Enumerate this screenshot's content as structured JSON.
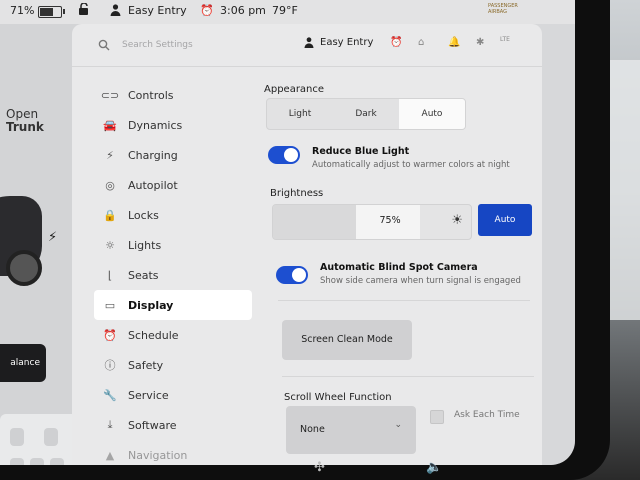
{
  "status_bar": {
    "battery_percent": "71%",
    "battery_level": 0.71,
    "profile_name": "Easy Entry",
    "time": "3:06 pm",
    "temperature": "79°F",
    "airbag_line1": "PASSENGER",
    "airbag_line2": "AIRBAG"
  },
  "car_panel": {
    "trunk_line1": "Open",
    "trunk_line2": "Trunk",
    "balance_label": "alance"
  },
  "settings_header": {
    "search_placeholder": "Search Settings",
    "profile_name": "Easy Entry",
    "lte_label": "LTE"
  },
  "sidebar": {
    "items": [
      {
        "label": "Controls",
        "icon": "toggle-icon"
      },
      {
        "label": "Dynamics",
        "icon": "car-icon"
      },
      {
        "label": "Charging",
        "icon": "bolt-icon"
      },
      {
        "label": "Autopilot",
        "icon": "steering-wheel-icon"
      },
      {
        "label": "Locks",
        "icon": "lock-icon"
      },
      {
        "label": "Lights",
        "icon": "light-icon"
      },
      {
        "label": "Seats",
        "icon": "seat-icon"
      },
      {
        "label": "Display",
        "icon": "display-icon",
        "active": true
      },
      {
        "label": "Schedule",
        "icon": "clock-icon"
      },
      {
        "label": "Safety",
        "icon": "info-icon"
      },
      {
        "label": "Service",
        "icon": "wrench-icon"
      },
      {
        "label": "Software",
        "icon": "download-icon"
      },
      {
        "label": "Navigation",
        "icon": "navigation-icon"
      }
    ]
  },
  "display": {
    "appearance_label": "Appearance",
    "appearance_options": [
      "Light",
      "Dark",
      "Auto"
    ],
    "appearance_selected": "Auto",
    "blue_light_title": "Reduce Blue Light",
    "blue_light_desc": "Automatically adjust to warmer colors at night",
    "blue_light_on": true,
    "brightness_label": "Brightness",
    "brightness_value": "75%",
    "brightness_level": 0.75,
    "brightness_auto_label": "Auto",
    "blind_spot_title": "Automatic Blind Spot Camera",
    "blind_spot_desc": "Show side camera when turn signal is engaged",
    "blind_spot_on": true,
    "screen_clean_label": "Screen Clean Mode",
    "scroll_wheel_label": "Scroll Wheel Function",
    "scroll_wheel_value": "None",
    "ask_each_time_label": "Ask Each Time"
  },
  "colors": {
    "accent": "#1d4fd0",
    "auto_button": "#1646c3",
    "panel_bg": "#e9e9ea"
  }
}
